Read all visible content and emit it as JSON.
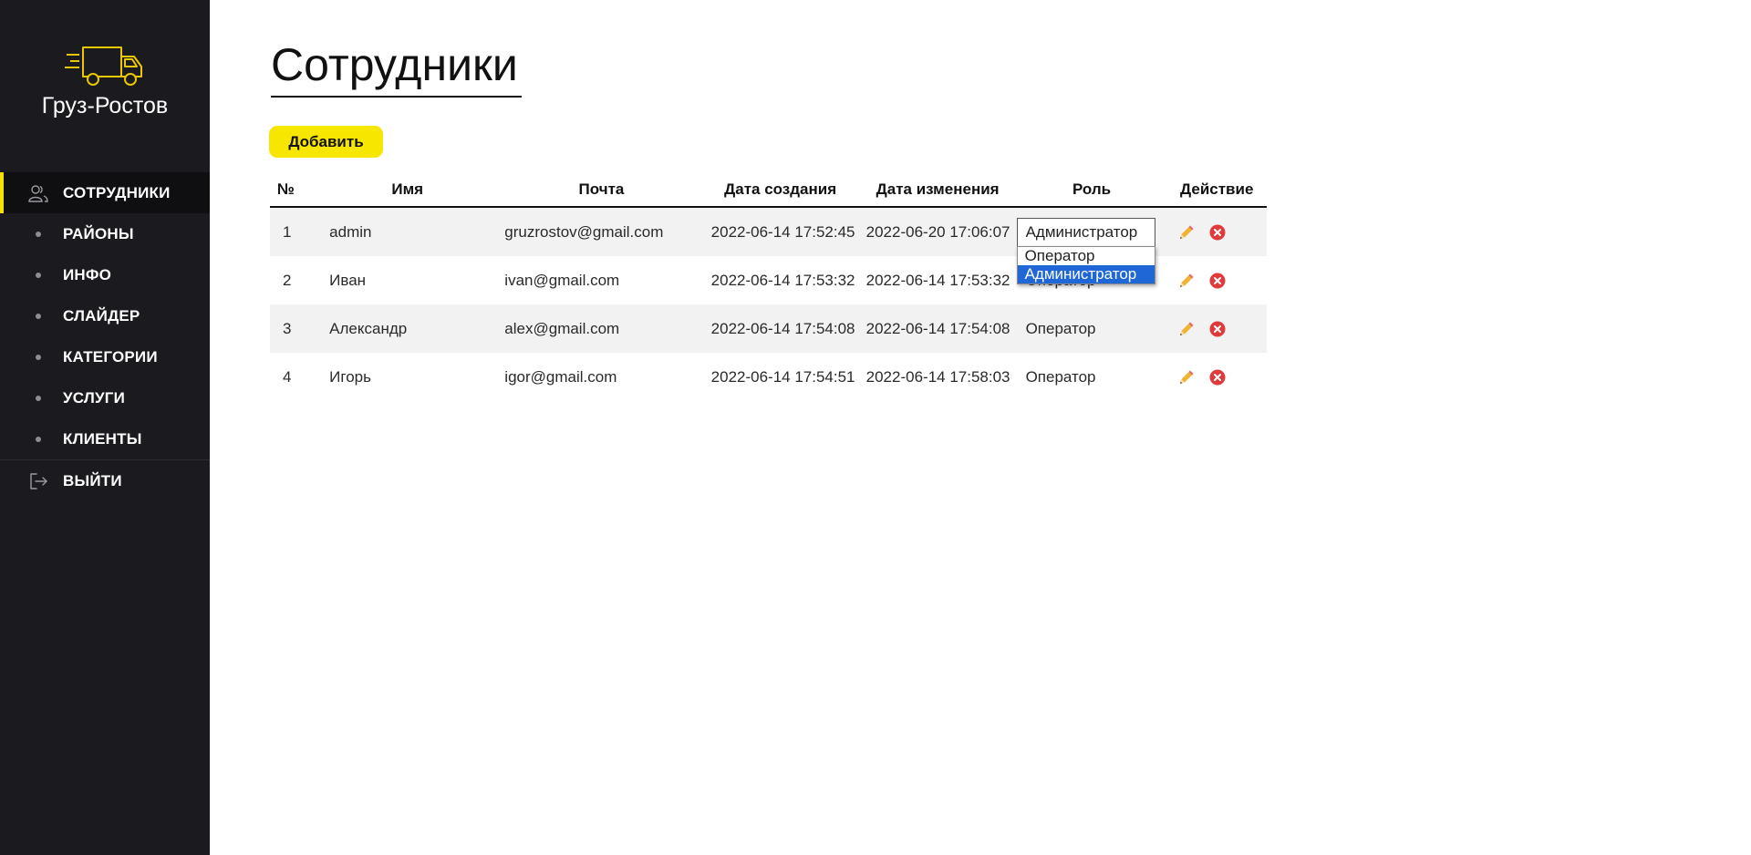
{
  "brand": {
    "name": "Груз-Ростов",
    "logo_icon": "truck-icon",
    "accent_color": "#f5e000"
  },
  "sidebar": {
    "items": [
      {
        "label": "СОТРУДНИКИ",
        "icon": "users-icon",
        "active": true
      },
      {
        "label": "РАЙОНЫ",
        "icon": "dot"
      },
      {
        "label": "ИНФО",
        "icon": "dot"
      },
      {
        "label": "СЛАЙДЕР",
        "icon": "dot"
      },
      {
        "label": "КАТЕГОРИИ",
        "icon": "dot"
      },
      {
        "label": "УСЛУГИ",
        "icon": "dot"
      },
      {
        "label": "КЛИЕНТЫ",
        "icon": "dot"
      },
      {
        "label": "ВЫЙТИ",
        "icon": "logout-icon"
      }
    ]
  },
  "main": {
    "title": "Сотрудники",
    "add_button": "Добавить"
  },
  "table": {
    "headers": [
      "№",
      "Имя",
      "Почта",
      "Дата создания",
      "Дата изменения",
      "Роль",
      "Действие"
    ],
    "rows": [
      {
        "num": "1",
        "name": "admin",
        "email": "gruzrostov@gmail.com",
        "created": "2022-06-14 17:52:45",
        "updated": "2022-06-20 17:06:07",
        "role": "Администратор"
      },
      {
        "num": "2",
        "name": "Иван",
        "email": "ivan@gmail.com",
        "created": "2022-06-14 17:53:32",
        "updated": "2022-06-14 17:53:32",
        "role": "Оператор"
      },
      {
        "num": "3",
        "name": "Александр",
        "email": "alex@gmail.com",
        "created": "2022-06-14 17:54:08",
        "updated": "2022-06-14 17:54:08",
        "role": "Оператор"
      },
      {
        "num": "4",
        "name": "Игорь",
        "email": "igor@gmail.com",
        "created": "2022-06-14 17:54:51",
        "updated": "2022-06-14 17:58:03",
        "role": "Оператор"
      }
    ],
    "row_actions": [
      "edit-pencil-icon",
      "delete-icon"
    ]
  },
  "role_dropdown": {
    "options": [
      "Оператор",
      "Администратор"
    ],
    "selected": "Администратор"
  }
}
